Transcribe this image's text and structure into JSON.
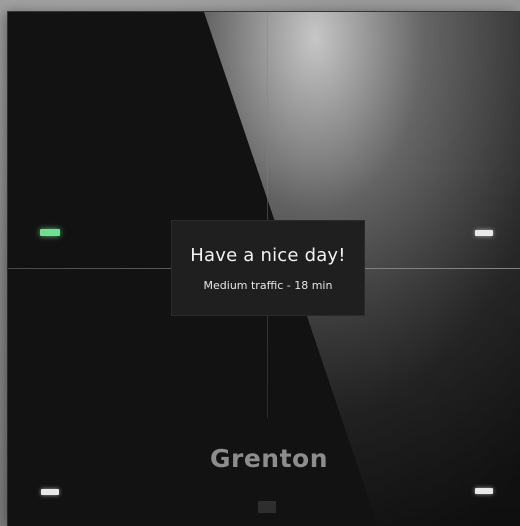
{
  "display": {
    "greeting": "Have a nice day!",
    "status": "Medium traffic - 18 min"
  },
  "brand": {
    "logo": "Grenton"
  },
  "indicators": {
    "top_left": {
      "color": "#6fe08e",
      "state": "on"
    },
    "top_right": {
      "color": "#e8e8e8",
      "state": "on"
    },
    "bottom_left": {
      "color": "#e8e8e8",
      "state": "on"
    },
    "bottom_right": {
      "color": "#e8e8e8",
      "state": "on"
    },
    "bottom_center": {
      "color": "#2e2e2e",
      "state": "off"
    }
  },
  "colors": {
    "panel": "#121212",
    "display_background": "#1f1f1f",
    "logo": "#8d8d8d"
  }
}
